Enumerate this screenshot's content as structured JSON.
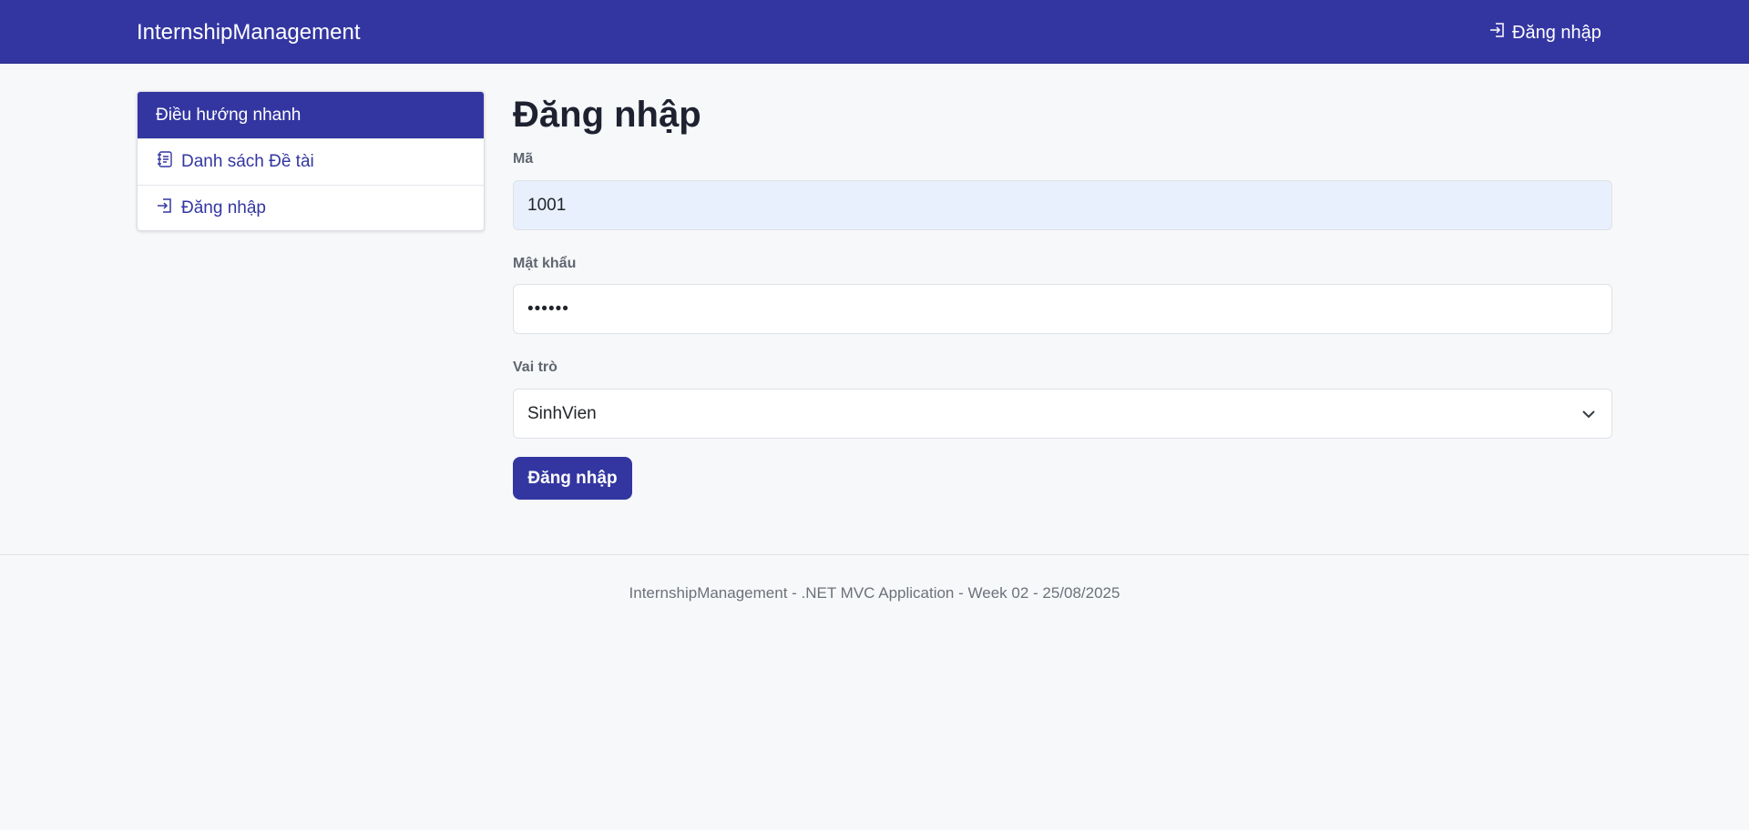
{
  "navbar": {
    "brand": "InternshipManagement",
    "login_label": "Đăng nhập",
    "bg_color": "#3336a1"
  },
  "sidebar": {
    "header": "Điều hướng nhanh",
    "items": [
      {
        "label": "Danh sách Đề tài",
        "icon": "journal-text-icon"
      },
      {
        "label": "Đăng nhập",
        "icon": "login-icon"
      }
    ]
  },
  "main": {
    "title": "Đăng nhập",
    "ma": {
      "label": "Mã",
      "value": "1001"
    },
    "password": {
      "label": "Mật khẩu",
      "value": "••••••"
    },
    "role": {
      "label": "Vai trò",
      "value": "SinhVien"
    },
    "submit_label": "Đăng nhập"
  },
  "footer": {
    "text": "InternshipManagement - .NET MVC Application - Week 02 - 25/08/2025"
  }
}
